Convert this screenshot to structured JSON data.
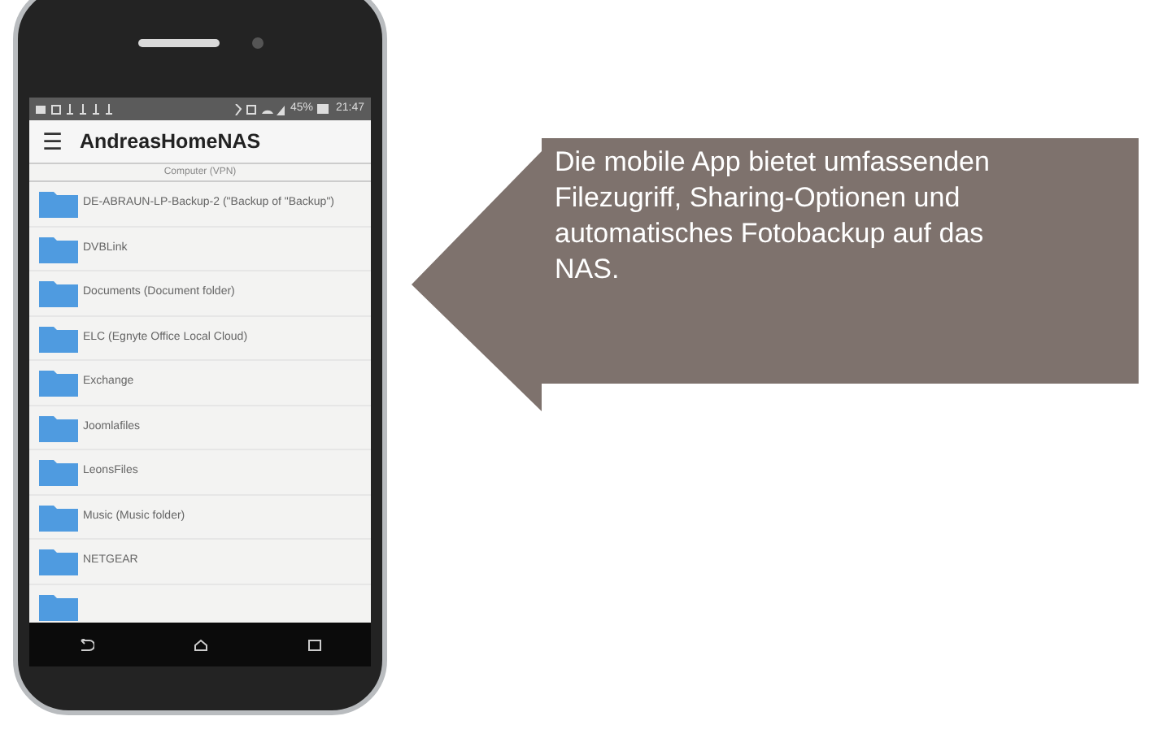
{
  "phone": {
    "status_bar": {
      "battery": "45%",
      "time": "21:47"
    },
    "app_bar": {
      "menu_icon": "☰",
      "title": "AndreasHomeNAS"
    },
    "subheader": "Computer (VPN)",
    "folders": [
      {
        "name": "DE-ABRAUN-LP-Backup-2 (\"Backup of \"Backup\")"
      },
      {
        "name": "DVBLink"
      },
      {
        "name": "Documents (Document folder)"
      },
      {
        "name": "ELC (Egnyte Office Local Cloud)"
      },
      {
        "name": "Exchange"
      },
      {
        "name": "Joomlafiles"
      },
      {
        "name": "LeonsFiles"
      },
      {
        "name": "Music (Music folder)"
      },
      {
        "name": "NETGEAR"
      }
    ]
  },
  "callout": {
    "text": "Die mobile App bietet umfassenden Filezugriff, Sharing-Optionen und automatisches Fotobackup auf das NAS."
  }
}
